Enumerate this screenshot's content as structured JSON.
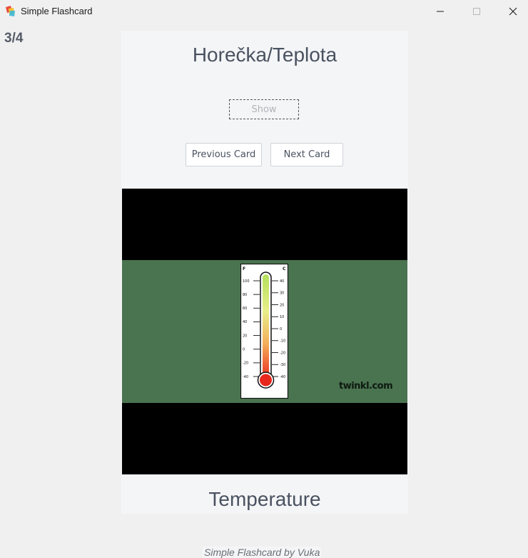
{
  "window": {
    "title": "Simple Flashcard",
    "app_icon": "flashcard-app-icon",
    "controls": [
      "minimize-icon",
      "maximize-icon",
      "close-icon"
    ]
  },
  "progress": {
    "counter": "3/4"
  },
  "card": {
    "question": "Horečka/Teplota",
    "show_label": "Show",
    "previous_label": "Previous Card",
    "next_label": "Next Card",
    "image": {
      "description_icon": "thermometer-image",
      "watermark": "twinkl.com",
      "thermometer": {
        "left_unit": "F",
        "right_unit": "C",
        "left_ticks": [
          "100",
          "80",
          "60",
          "40",
          "20",
          "0",
          "-20",
          "-40"
        ],
        "right_ticks": [
          "40",
          "30",
          "20",
          "10",
          "0",
          "-10",
          "-20",
          "-30",
          "-40"
        ]
      }
    },
    "answer": "Temperature"
  },
  "footer": {
    "text": "Simple Flashcard by Vuka"
  },
  "colors": {
    "background": "#f0f0f0",
    "card_background": "#f4f5f7",
    "text": "#4a5260",
    "image_band": "#4a7350"
  }
}
